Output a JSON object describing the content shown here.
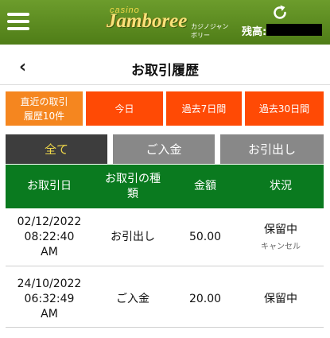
{
  "header": {
    "logo_casino": "casino",
    "logo_main": "Jamboree",
    "logo_sub": "カジノジャンボリー",
    "balance_label": "残高:",
    "menu_icon": "hamburger-icon",
    "refresh_icon": "refresh-icon"
  },
  "page": {
    "title": "お取引履歴",
    "back_symbol": "‹"
  },
  "periods": [
    {
      "line1": "直近の取引",
      "line2": "履歴10件",
      "active": true
    },
    {
      "line1": "今日",
      "line2": "",
      "active": false
    },
    {
      "line1": "過去7日間",
      "line2": "",
      "active": false
    },
    {
      "line1": "過去30日間",
      "line2": "",
      "active": false
    }
  ],
  "tabs": [
    {
      "label": "全て",
      "active": true
    },
    {
      "label": "ご入金",
      "active": false
    },
    {
      "label": "お引出し",
      "active": false
    }
  ],
  "table": {
    "headers": [
      "お取引日",
      "お取引の種類",
      "金額",
      "状況"
    ],
    "header_col2_line1": "お取引の種",
    "header_col2_line2": "類",
    "rows": [
      {
        "date_line1": "02/12/2022",
        "date_line2": "08:22:40",
        "date_line3": "AM",
        "type": "お引出し",
        "amount": "50.00",
        "status": "保留中",
        "action": "キャンセル"
      },
      {
        "date_line1": "24/10/2022",
        "date_line2": "06:32:49",
        "date_line3": "AM",
        "type": "ご入金",
        "amount": "20.00",
        "status": "保留中",
        "action": ""
      }
    ]
  },
  "colors": {
    "header_green": "#5a8a20",
    "period_orange": "#ff4a05",
    "period_active": "#f5861f",
    "tab_active": "#3d3d3d",
    "tab_active_text": "#f0d84a",
    "tab_inactive": "#888888",
    "table_header": "#0a7a1f"
  }
}
